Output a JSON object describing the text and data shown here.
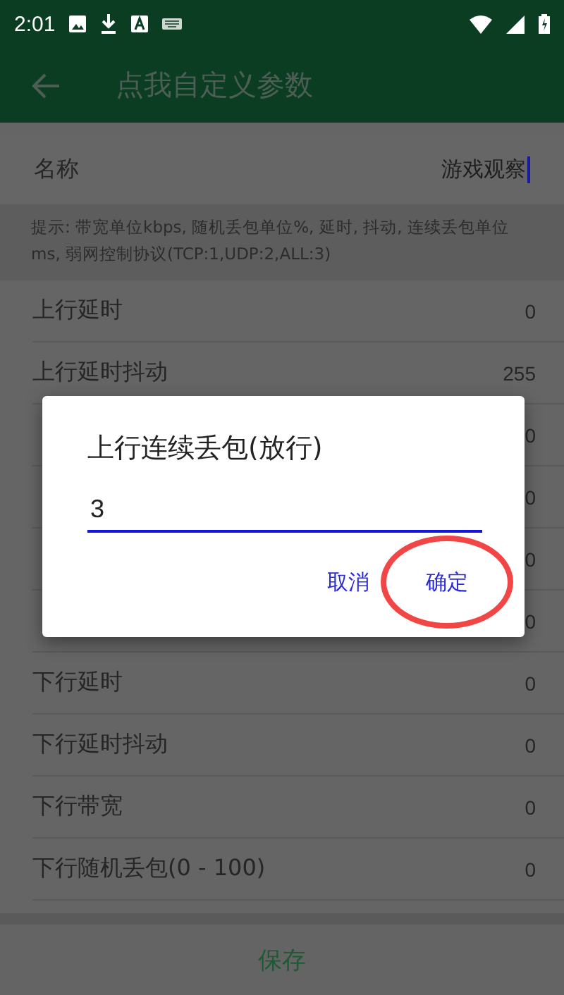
{
  "status_bar": {
    "time": "2:01"
  },
  "app_bar": {
    "title": "点我自定义参数"
  },
  "name_field": {
    "label": "名称",
    "value": "游戏观察"
  },
  "hint": "提示: 带宽单位kbps, 随机丢包单位%, 延时, 抖动, 连续丢包单位ms, 弱网控制协议(TCP:1,UDP:2,ALL:3)",
  "rows": [
    {
      "label": "上行延时",
      "value": "0"
    },
    {
      "label": "上行延时抖动",
      "value": "255"
    },
    {
      "value": "0"
    },
    {
      "value": "0"
    },
    {
      "value": "0"
    },
    {
      "value": "0"
    },
    {
      "label": "下行延时",
      "value": "0"
    },
    {
      "label": "下行延时抖动",
      "value": "0"
    },
    {
      "label": "下行带宽",
      "value": "0"
    },
    {
      "label": "下行随机丢包(0 - 100)",
      "value": "0"
    }
  ],
  "save_button": "保存",
  "dialog": {
    "title": "上行连续丢包(放行)",
    "value": "3",
    "buttons": [
      {
        "label": "取消",
        "highlighted": false
      },
      {
        "label": "确定",
        "highlighted": true
      }
    ]
  }
}
